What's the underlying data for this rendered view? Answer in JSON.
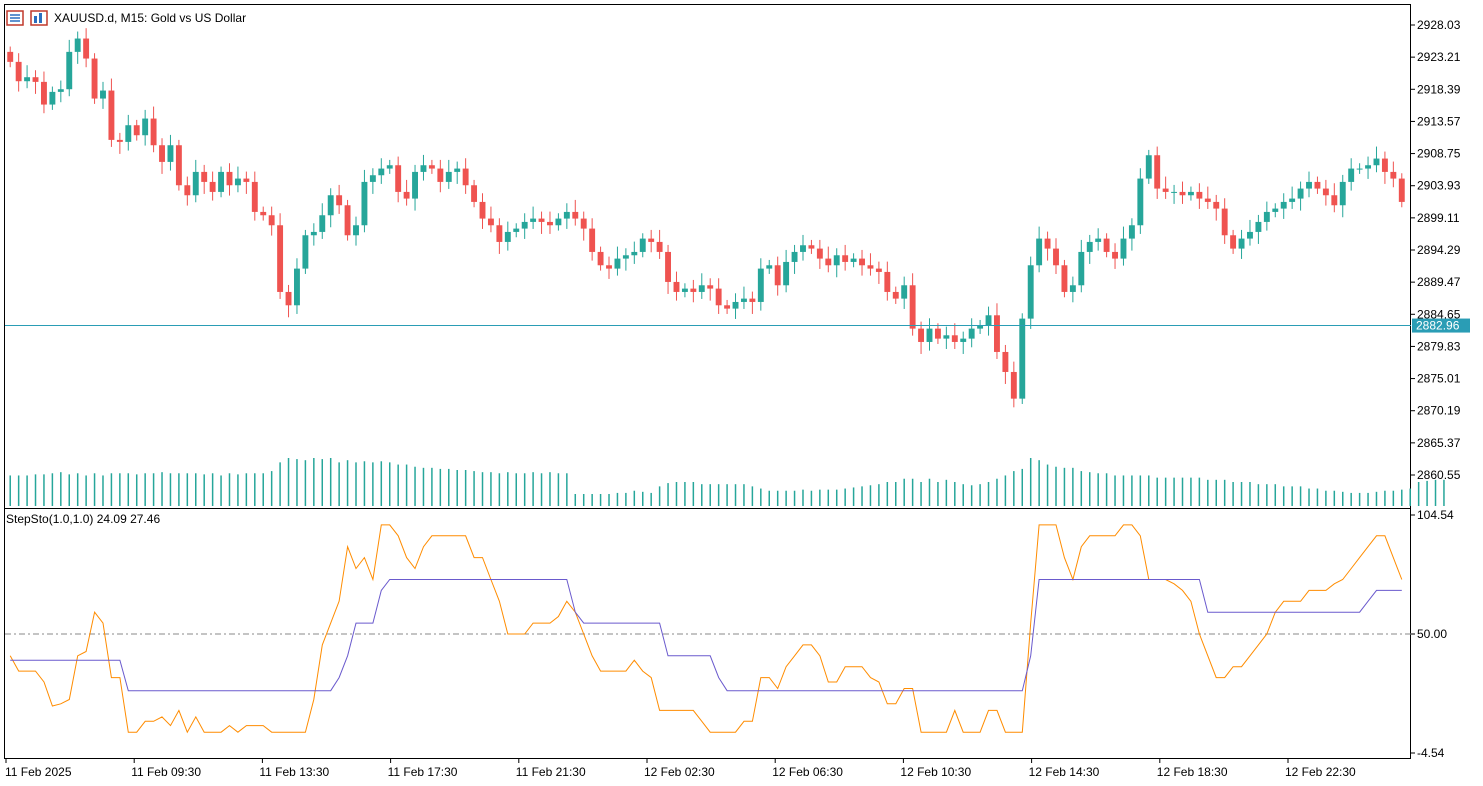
{
  "header": {
    "title": "XAUUSD.d, M15:  Gold vs US Dollar",
    "icons": [
      "trade-panel-icon",
      "chart-settings-icon"
    ]
  },
  "price_axis": {
    "labels": [
      "2928.03",
      "2923.21",
      "2918.39",
      "2913.57",
      "2908.75",
      "2903.93",
      "2899.11",
      "2894.29",
      "2889.47",
      "2884.65",
      "2879.83",
      "2875.01",
      "2870.19",
      "2865.37",
      "2860.55"
    ],
    "current_price": "2882.96"
  },
  "indicator": {
    "title": "StepSto(1.0,1.0) 24.09 27.46",
    "axis_labels": [
      "104.54",
      "50.00",
      "-4.54"
    ]
  },
  "time_axis": {
    "labels": [
      "11 Feb 2025",
      "11 Feb 09:30",
      "11 Feb 13:30",
      "11 Feb 17:30",
      "11 Feb 21:30",
      "12 Feb 02:30",
      "12 Feb 06:30",
      "12 Feb 10:30",
      "12 Feb 14:30",
      "12 Feb 18:30",
      "12 Feb 22:30"
    ]
  },
  "colors": {
    "bull": "#26a69a",
    "bear": "#ef5350",
    "volume": "#26a69a",
    "current_price_line": "#2a9db5",
    "fast_line": "#ff8c00",
    "slow_line": "#6a5acd",
    "grid": "#888888"
  },
  "chart_data": [
    {
      "type": "candlestick",
      "symbol": "XAUUSD.d",
      "timeframe": "M15",
      "ylim": [
        2860.55,
        2928.03
      ],
      "current_price": 2882.96,
      "close": [
        2922.5,
        2919.6,
        2920.2,
        2919.5,
        2916.1,
        2918.0,
        2918.4,
        2924.0,
        2926.0,
        2923.0,
        2917.0,
        2918.2,
        2910.8,
        2910.5,
        2913.0,
        2911.5,
        2914.0,
        2910.0,
        2907.5,
        2910.0,
        2904.0,
        2902.5,
        2906.0,
        2904.5,
        2903.0,
        2906.0,
        2904.0,
        2905.0,
        2904.5,
        2900.0,
        2899.5,
        2898.0,
        2888.0,
        2886.0,
        2891.5,
        2896.5,
        2897.0,
        2899.5,
        2902.5,
        2901.0,
        2896.5,
        2898.0,
        2904.5,
        2905.5,
        2906.5,
        2907.0,
        2903.0,
        2902.0,
        2906.0,
        2907.0,
        2906.5,
        2904.5,
        2906.0,
        2906.5,
        2904.0,
        2901.5,
        2899.0,
        2898.0,
        2895.5,
        2897.0,
        2897.5,
        2898.5,
        2899.0,
        2898.5,
        2898.0,
        2899.0,
        2900.0,
        2899.0,
        2897.5,
        2894.0,
        2892.0,
        2891.5,
        2893.0,
        2893.5,
        2894.0,
        2896.0,
        2895.5,
        2894.0,
        2889.5,
        2888.0,
        2888.5,
        2888.0,
        2889.0,
        2888.5,
        2886.0,
        2885.5,
        2886.5,
        2887.0,
        2886.5,
        2891.5,
        2892.0,
        2889.0,
        2892.5,
        2894.0,
        2895.0,
        2894.5,
        2893.0,
        2892.0,
        2893.5,
        2892.5,
        2893.0,
        2892.0,
        2891.5,
        2891.0,
        2888.0,
        2887.0,
        2889.0,
        2882.5,
        2880.5,
        2882.5,
        2881.0,
        2881.5,
        2880.5,
        2881.0,
        2882.5,
        2883.0,
        2884.5,
        2879.0,
        2876.0,
        2872.0,
        2884.0,
        2892.0,
        2896.0,
        2894.5,
        2892.0,
        2888.0,
        2889.0,
        2894.0,
        2895.5,
        2896.0,
        2894.0,
        2893.0,
        2896.0,
        2898.0,
        2905.0,
        2908.5,
        2903.5,
        2903.0,
        2903.0,
        2902.5,
        2903.0,
        2902.0,
        2901.5,
        2900.5,
        2896.5,
        2894.5,
        2896.0,
        2897.0,
        2898.5,
        2900.0,
        2900.5,
        2901.5,
        2902.0,
        2903.5,
        2904.5,
        2903.5,
        2902.5,
        2901.0,
        2904.5,
        2906.5,
        2906.5,
        2907.0,
        2908.0,
        2906.0,
        2905.0,
        2901.5
      ],
      "volume": [
        28,
        28,
        28,
        29,
        29,
        30,
        31,
        29,
        30,
        28,
        30,
        28,
        30,
        30,
        30,
        29,
        30,
        30,
        31,
        30,
        30,
        30,
        30,
        29,
        30,
        28,
        30,
        29,
        30,
        30,
        30,
        32,
        40,
        44,
        43,
        42,
        44,
        43,
        44,
        40,
        42,
        40,
        41,
        40,
        41,
        40,
        38,
        38,
        36,
        35,
        35,
        34,
        34,
        33,
        33,
        32,
        31,
        31,
        30,
        31,
        30,
        30,
        31,
        30,
        31,
        30,
        30,
        11,
        11,
        11,
        11,
        11,
        12,
        12,
        14,
        13,
        12,
        18,
        21,
        22,
        22,
        22,
        20,
        20,
        20,
        20,
        20,
        20,
        18,
        16,
        14,
        14,
        14,
        14,
        15,
        14,
        15,
        15,
        15,
        16,
        17,
        18,
        19,
        20,
        22,
        22,
        25,
        25,
        22,
        25,
        22,
        24,
        22,
        20,
        19,
        20,
        22,
        25,
        28,
        32,
        34,
        44,
        42,
        38,
        36,
        35,
        35,
        32,
        31,
        30,
        30,
        28,
        28,
        28,
        28,
        28,
        26,
        26,
        26,
        26,
        26,
        26,
        24,
        24,
        24,
        22,
        22,
        22,
        20,
        20,
        20,
        18,
        18,
        18,
        16,
        16,
        14,
        14,
        13,
        12,
        12,
        12,
        13,
        14,
        14,
        15,
        16,
        22,
        23,
        24,
        24
      ]
    },
    {
      "type": "line",
      "name": "StepSto(1.0,1.0)",
      "ylim": [
        -4.54,
        104.54
      ],
      "reference_line": 50.0,
      "last_values": [
        24.09,
        27.46
      ],
      "series": [
        {
          "values": [
            40,
            33,
            33,
            33,
            28,
            17,
            18,
            20,
            40,
            42,
            60,
            55,
            30,
            30,
            5,
            5,
            10,
            10,
            12,
            8,
            15,
            5,
            12,
            5,
            5,
            5,
            8,
            5,
            8,
            8,
            8,
            5,
            5,
            5,
            5,
            5,
            20,
            45,
            55,
            65,
            90,
            80,
            85,
            75,
            100,
            100,
            95,
            85,
            80,
            90,
            95,
            95,
            95,
            95,
            95,
            85,
            85,
            75,
            65,
            50,
            50,
            50,
            55,
            55,
            55,
            58,
            65,
            60,
            50,
            40,
            33,
            33,
            33,
            33,
            38,
            33,
            30,
            15,
            15,
            15,
            15,
            15,
            10,
            5,
            5,
            5,
            5,
            10,
            10,
            30,
            30,
            25,
            35,
            40,
            45,
            45,
            40,
            28,
            28,
            35,
            35,
            35,
            30,
            28,
            18,
            18,
            25,
            25,
            5,
            5,
            5,
            5,
            15,
            5,
            5,
            5,
            15,
            15,
            5,
            5,
            5,
            55,
            100,
            100,
            100,
            85,
            75,
            90,
            95,
            95,
            95,
            95,
            100,
            100,
            95,
            75,
            75,
            75,
            73,
            70,
            65,
            50,
            40,
            30,
            30,
            35,
            35,
            40,
            45,
            50,
            60,
            65,
            65,
            65,
            70,
            70,
            70,
            73,
            75,
            80,
            85,
            90,
            95,
            95,
            85,
            75
          ]
        },
        {
          "values": [
            38,
            38,
            38,
            38,
            38,
            38,
            38,
            38,
            38,
            38,
            38,
            38,
            38,
            38,
            24,
            24,
            24,
            24,
            24,
            24,
            24,
            24,
            24,
            24,
            24,
            24,
            24,
            24,
            24,
            24,
            24,
            24,
            24,
            24,
            24,
            24,
            24,
            24,
            24,
            30,
            40,
            55,
            55,
            55,
            70,
            75,
            75,
            75,
            75,
            75,
            75,
            75,
            75,
            75,
            75,
            75,
            75,
            75,
            75,
            75,
            75,
            75,
            75,
            75,
            75,
            75,
            75,
            60,
            55,
            55,
            55,
            55,
            55,
            55,
            55,
            55,
            55,
            55,
            40,
            40,
            40,
            40,
            40,
            40,
            30,
            24,
            24,
            24,
            24,
            24,
            24,
            24,
            24,
            24,
            24,
            24,
            24,
            24,
            24,
            24,
            24,
            24,
            24,
            24,
            24,
            24,
            24,
            24,
            24,
            24,
            24,
            24,
            24,
            24,
            24,
            24,
            24,
            24,
            24,
            24,
            24,
            40,
            75,
            75,
            75,
            75,
            75,
            75,
            75,
            75,
            75,
            75,
            75,
            75,
            75,
            75,
            75,
            75,
            75,
            75,
            75,
            75,
            60,
            60,
            60,
            60,
            60,
            60,
            60,
            60,
            60,
            60,
            60,
            60,
            60,
            60,
            60,
            60,
            60,
            60,
            60,
            65,
            70,
            70,
            70,
            70
          ]
        }
      ]
    }
  ]
}
